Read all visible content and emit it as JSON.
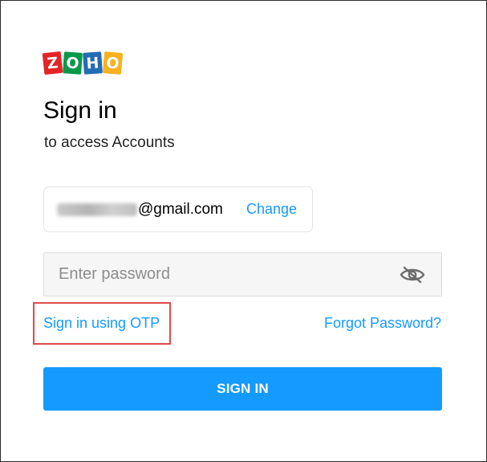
{
  "brand": {
    "letters": [
      "Z",
      "O",
      "H",
      "O"
    ],
    "colors": [
      "#e42527",
      "#089949",
      "#226db4",
      "#f9b21d"
    ]
  },
  "header": {
    "title": "Sign in",
    "subtitle": "to access Accounts"
  },
  "account": {
    "email_domain": "@gmail.com",
    "change_label": "Change"
  },
  "password": {
    "placeholder": "Enter password",
    "value": "",
    "visibility_icon": "eye-slash-icon"
  },
  "links": {
    "otp_label": "Sign in using OTP",
    "forgot_label": "Forgot Password?"
  },
  "actions": {
    "signin_label": "SIGN IN"
  },
  "colors": {
    "accent": "#159aff",
    "highlight": "#e04a4a"
  }
}
